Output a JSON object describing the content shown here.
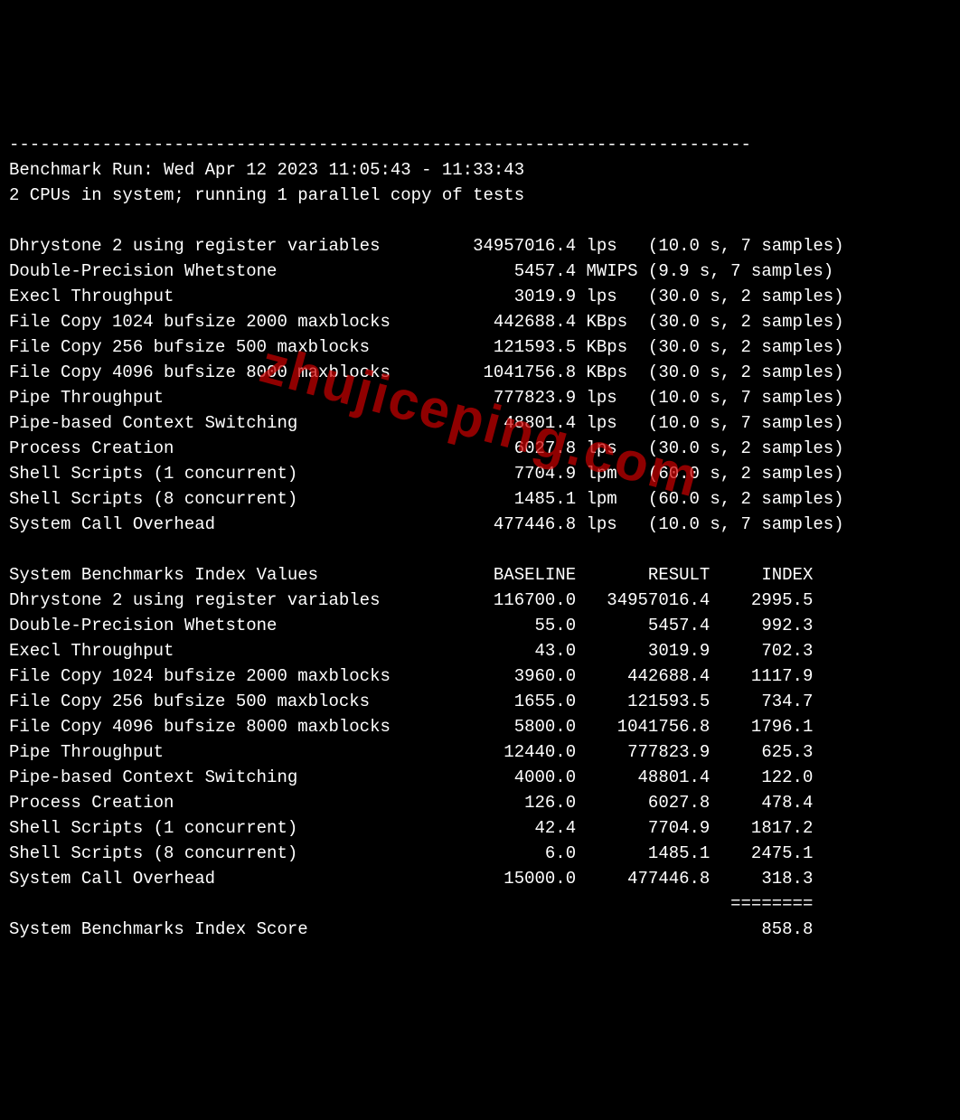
{
  "watermark": "zhujiceping.com",
  "header": {
    "dashes": "------------------------------------------------------------------------",
    "run": "Benchmark Run: Wed Apr 12 2023 11:05:43 - 11:33:43",
    "cpus": "2 CPUs in system; running 1 parallel copy of tests"
  },
  "tests": [
    {
      "name": "Dhrystone 2 using register variables",
      "value": "34957016.4",
      "unit": "lps",
      "timing": "(10.0 s, 7 samples)"
    },
    {
      "name": "Double-Precision Whetstone",
      "value": "5457.4",
      "unit": "MWIPS",
      "timing": "(9.9 s, 7 samples)"
    },
    {
      "name": "Execl Throughput",
      "value": "3019.9",
      "unit": "lps",
      "timing": "(30.0 s, 2 samples)"
    },
    {
      "name": "File Copy 1024 bufsize 2000 maxblocks",
      "value": "442688.4",
      "unit": "KBps",
      "timing": "(30.0 s, 2 samples)"
    },
    {
      "name": "File Copy 256 bufsize 500 maxblocks",
      "value": "121593.5",
      "unit": "KBps",
      "timing": "(30.0 s, 2 samples)"
    },
    {
      "name": "File Copy 4096 bufsize 8000 maxblocks",
      "value": "1041756.8",
      "unit": "KBps",
      "timing": "(30.0 s, 2 samples)"
    },
    {
      "name": "Pipe Throughput",
      "value": "777823.9",
      "unit": "lps",
      "timing": "(10.0 s, 7 samples)"
    },
    {
      "name": "Pipe-based Context Switching",
      "value": "48801.4",
      "unit": "lps",
      "timing": "(10.0 s, 7 samples)"
    },
    {
      "name": "Process Creation",
      "value": "6027.8",
      "unit": "lps",
      "timing": "(30.0 s, 2 samples)"
    },
    {
      "name": "Shell Scripts (1 concurrent)",
      "value": "7704.9",
      "unit": "lpm",
      "timing": "(60.0 s, 2 samples)"
    },
    {
      "name": "Shell Scripts (8 concurrent)",
      "value": "1485.1",
      "unit": "lpm",
      "timing": "(60.0 s, 2 samples)"
    },
    {
      "name": "System Call Overhead",
      "value": "477446.8",
      "unit": "lps",
      "timing": "(10.0 s, 7 samples)"
    }
  ],
  "indexHeader": {
    "title": "System Benchmarks Index Values",
    "c1": "BASELINE",
    "c2": "RESULT",
    "c3": "INDEX"
  },
  "index": [
    {
      "name": "Dhrystone 2 using register variables",
      "baseline": "116700.0",
      "result": "34957016.4",
      "idx": "2995.5"
    },
    {
      "name": "Double-Precision Whetstone",
      "baseline": "55.0",
      "result": "5457.4",
      "idx": "992.3"
    },
    {
      "name": "Execl Throughput",
      "baseline": "43.0",
      "result": "3019.9",
      "idx": "702.3"
    },
    {
      "name": "File Copy 1024 bufsize 2000 maxblocks",
      "baseline": "3960.0",
      "result": "442688.4",
      "idx": "1117.9"
    },
    {
      "name": "File Copy 256 bufsize 500 maxblocks",
      "baseline": "1655.0",
      "result": "121593.5",
      "idx": "734.7"
    },
    {
      "name": "File Copy 4096 bufsize 8000 maxblocks",
      "baseline": "5800.0",
      "result": "1041756.8",
      "idx": "1796.1"
    },
    {
      "name": "Pipe Throughput",
      "baseline": "12440.0",
      "result": "777823.9",
      "idx": "625.3"
    },
    {
      "name": "Pipe-based Context Switching",
      "baseline": "4000.0",
      "result": "48801.4",
      "idx": "122.0"
    },
    {
      "name": "Process Creation",
      "baseline": "126.0",
      "result": "6027.8",
      "idx": "478.4"
    },
    {
      "name": "Shell Scripts (1 concurrent)",
      "baseline": "42.4",
      "result": "7704.9",
      "idx": "1817.2"
    },
    {
      "name": "Shell Scripts (8 concurrent)",
      "baseline": "6.0",
      "result": "1485.1",
      "idx": "2475.1"
    },
    {
      "name": "System Call Overhead",
      "baseline": "15000.0",
      "result": "477446.8",
      "idx": "318.3"
    }
  ],
  "scoreLine": {
    "rule": "========",
    "label": "System Benchmarks Index Score",
    "value": "858.8"
  }
}
